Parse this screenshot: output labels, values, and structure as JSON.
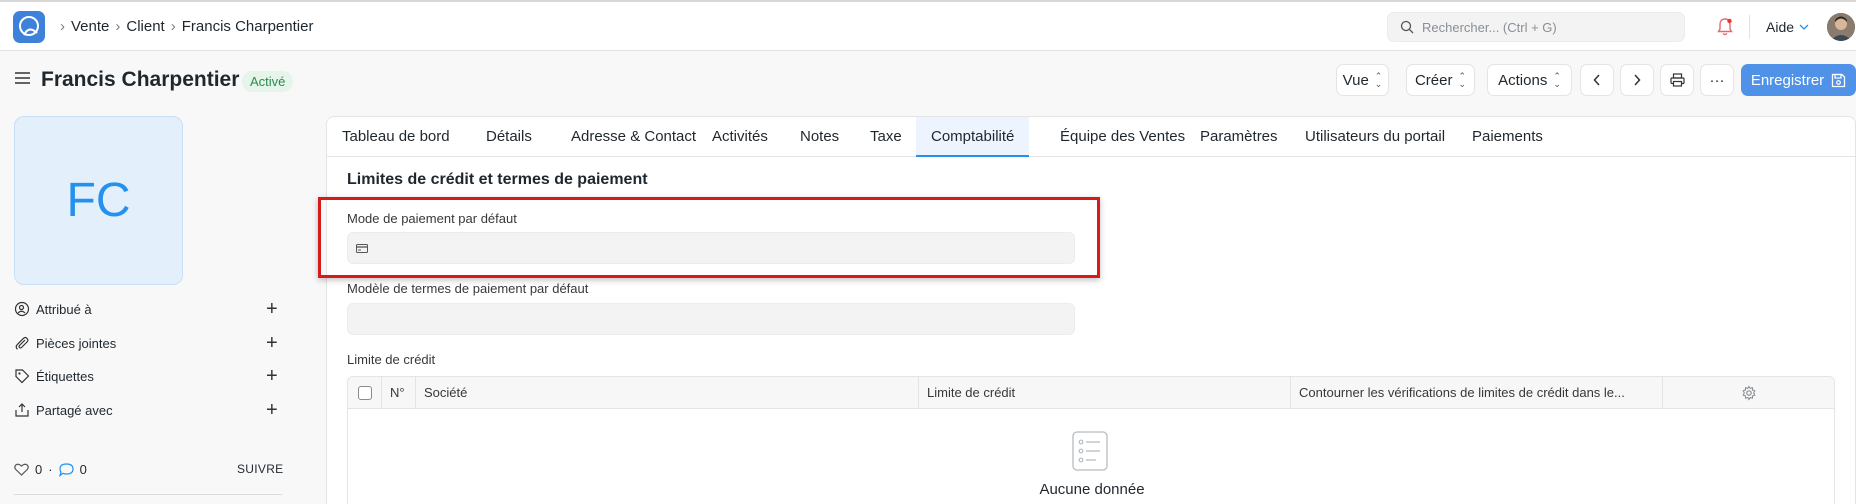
{
  "breadcrumbs": [
    "Vente",
    "Client",
    "Francis Charpentier"
  ],
  "search": {
    "placeholder": "Rechercher... (Ctrl + G)"
  },
  "help_label": "Aide",
  "page": {
    "title": "Francis Charpentier",
    "status": "Activé"
  },
  "header_buttons": {
    "view": "Vue",
    "create": "Créer",
    "actions": "Actions",
    "more": "···",
    "save": "Enregistrer"
  },
  "sidebar": {
    "initials": "FC",
    "items": [
      {
        "label": "Attribué à",
        "icon": "user-plus-icon"
      },
      {
        "label": "Pièces jointes",
        "icon": "paperclip-icon"
      },
      {
        "label": "Étiquettes",
        "icon": "tag-icon"
      },
      {
        "label": "Partagé avec",
        "icon": "share-icon"
      }
    ],
    "likes": "0",
    "comments": "0",
    "follow": "SUIVRE"
  },
  "tabs": [
    {
      "label": "Tableau de bord",
      "active": false
    },
    {
      "label": "Détails",
      "active": false
    },
    {
      "label": "Adresse & Contact",
      "active": false
    },
    {
      "label": "Activités",
      "active": false
    },
    {
      "label": "Notes",
      "active": false
    },
    {
      "label": "Taxe",
      "active": false
    },
    {
      "label": "Comptabilité",
      "active": true
    },
    {
      "label": "Équipe des Ventes",
      "active": false
    },
    {
      "label": "Paramètres",
      "active": false
    },
    {
      "label": "Utilisateurs du portail",
      "active": false
    },
    {
      "label": "Paiements",
      "active": false
    }
  ],
  "section": {
    "title": "Limites de crédit et termes de paiement",
    "field_payment_mode": {
      "label": "Mode de paiement par défaut",
      "value": ""
    },
    "field_payment_terms": {
      "label": "Modèle de termes de paiement par défaut",
      "value": ""
    },
    "credit_limit_label": "Limite de crédit"
  },
  "credit_table": {
    "columns": [
      "N°",
      "Société",
      "Limite de crédit",
      "Contourner les vérifications de limites de crédit dans le..."
    ],
    "rows": [],
    "empty_text": "Aucune donnée"
  },
  "colors": {
    "accent": "#2490ef",
    "primary_button": "#4f92e8",
    "highlight": "#d51b1b",
    "status_bg": "#e5f5ea",
    "status_fg": "#2c8a4f"
  }
}
